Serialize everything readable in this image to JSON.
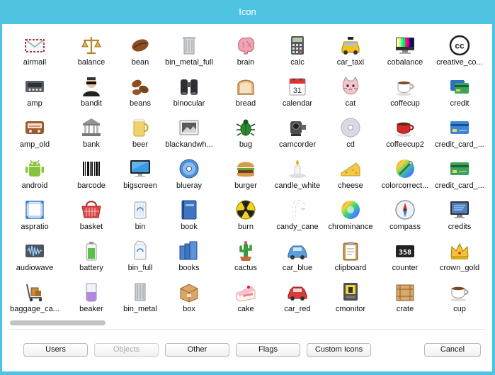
{
  "window": {
    "title": "Icon"
  },
  "icons": [
    {
      "label": "airmail",
      "icon": "airmail-icon"
    },
    {
      "label": "balance",
      "icon": "balance-icon"
    },
    {
      "label": "bean",
      "icon": "bean-icon"
    },
    {
      "label": "bin_metal_full",
      "icon": "bin-metal-full-icon"
    },
    {
      "label": "brain",
      "icon": "brain-icon"
    },
    {
      "label": "calc",
      "icon": "calc-icon"
    },
    {
      "label": "car_taxi",
      "icon": "car-taxi-icon"
    },
    {
      "label": "cobalance",
      "icon": "cobalance-icon"
    },
    {
      "label": "creative_co...",
      "icon": "creative-commons-icon"
    },
    {
      "label": "amp",
      "icon": "amp-icon"
    },
    {
      "label": "bandit",
      "icon": "bandit-icon"
    },
    {
      "label": "beans",
      "icon": "beans-icon"
    },
    {
      "label": "binocular",
      "icon": "binocular-icon"
    },
    {
      "label": "bread",
      "icon": "bread-icon"
    },
    {
      "label": "calendar",
      "icon": "calendar-icon"
    },
    {
      "label": "cat",
      "icon": "cat-icon"
    },
    {
      "label": "coffecup",
      "icon": "coffecup-icon"
    },
    {
      "label": "credit",
      "icon": "credit-icon"
    },
    {
      "label": "amp_old",
      "icon": "amp-old-icon"
    },
    {
      "label": "bank",
      "icon": "bank-icon"
    },
    {
      "label": "beer",
      "icon": "beer-icon"
    },
    {
      "label": "blackandwh...",
      "icon": "blackandwhite-icon"
    },
    {
      "label": "bug",
      "icon": "bug-icon"
    },
    {
      "label": "camcorder",
      "icon": "camcorder-icon"
    },
    {
      "label": "cd",
      "icon": "cd-icon"
    },
    {
      "label": "coffeecup2",
      "icon": "coffeecup2-icon"
    },
    {
      "label": "credit_card_...",
      "icon": "credit-card-icon"
    },
    {
      "label": "android",
      "icon": "android-icon"
    },
    {
      "label": "barcode",
      "icon": "barcode-icon"
    },
    {
      "label": "bigscreen",
      "icon": "bigscreen-icon"
    },
    {
      "label": "blueray",
      "icon": "blueray-icon"
    },
    {
      "label": "burger",
      "icon": "burger-icon"
    },
    {
      "label": "candle_white",
      "icon": "candle-white-icon"
    },
    {
      "label": "cheese",
      "icon": "cheese-icon"
    },
    {
      "label": "colorcorrect...",
      "icon": "colorcorrect-icon"
    },
    {
      "label": "credit_card_...",
      "icon": "credit-card-green-icon"
    },
    {
      "label": "aspratio",
      "icon": "aspratio-icon"
    },
    {
      "label": "basket",
      "icon": "basket-icon"
    },
    {
      "label": "bin",
      "icon": "bin-icon"
    },
    {
      "label": "book",
      "icon": "book-icon"
    },
    {
      "label": "burn",
      "icon": "burn-icon"
    },
    {
      "label": "candy_cane",
      "icon": "candy-cane-icon"
    },
    {
      "label": "chrominance",
      "icon": "chrominance-icon"
    },
    {
      "label": "compass",
      "icon": "compass-icon"
    },
    {
      "label": "credits",
      "icon": "credits-icon"
    },
    {
      "label": "audiowave",
      "icon": "audiowave-icon"
    },
    {
      "label": "battery",
      "icon": "battery-icon"
    },
    {
      "label": "bin_full",
      "icon": "bin-full-icon"
    },
    {
      "label": "books",
      "icon": "books-icon"
    },
    {
      "label": "cactus",
      "icon": "cactus-icon"
    },
    {
      "label": "car_blue",
      "icon": "car-blue-icon"
    },
    {
      "label": "clipboard",
      "icon": "clipboard-icon"
    },
    {
      "label": "counter",
      "icon": "counter-icon"
    },
    {
      "label": "crown_gold",
      "icon": "crown-gold-icon"
    },
    {
      "label": "baggage_ca...",
      "icon": "baggage-cart-icon"
    },
    {
      "label": "beaker",
      "icon": "beaker-icon"
    },
    {
      "label": "bin_metal",
      "icon": "bin-metal-icon"
    },
    {
      "label": "box",
      "icon": "box-icon"
    },
    {
      "label": "cake",
      "icon": "cake-icon"
    },
    {
      "label": "car_red",
      "icon": "car-red-icon"
    },
    {
      "label": "cmonitor",
      "icon": "cmonitor-icon"
    },
    {
      "label": "crate",
      "icon": "crate-icon"
    },
    {
      "label": "cup",
      "icon": "cup-icon"
    }
  ],
  "counter_icon_text": "358",
  "calendar_icon_text": "31",
  "creative_commons_icon_text": "cc",
  "buttons": {
    "users": "Users",
    "objects": "Objects",
    "other": "Other",
    "flags": "Flags",
    "custom_icons": "Custom Icons",
    "cancel": "Cancel"
  },
  "colors": {
    "titlebar": "#4ec3e2",
    "panel": "#ffffff"
  }
}
